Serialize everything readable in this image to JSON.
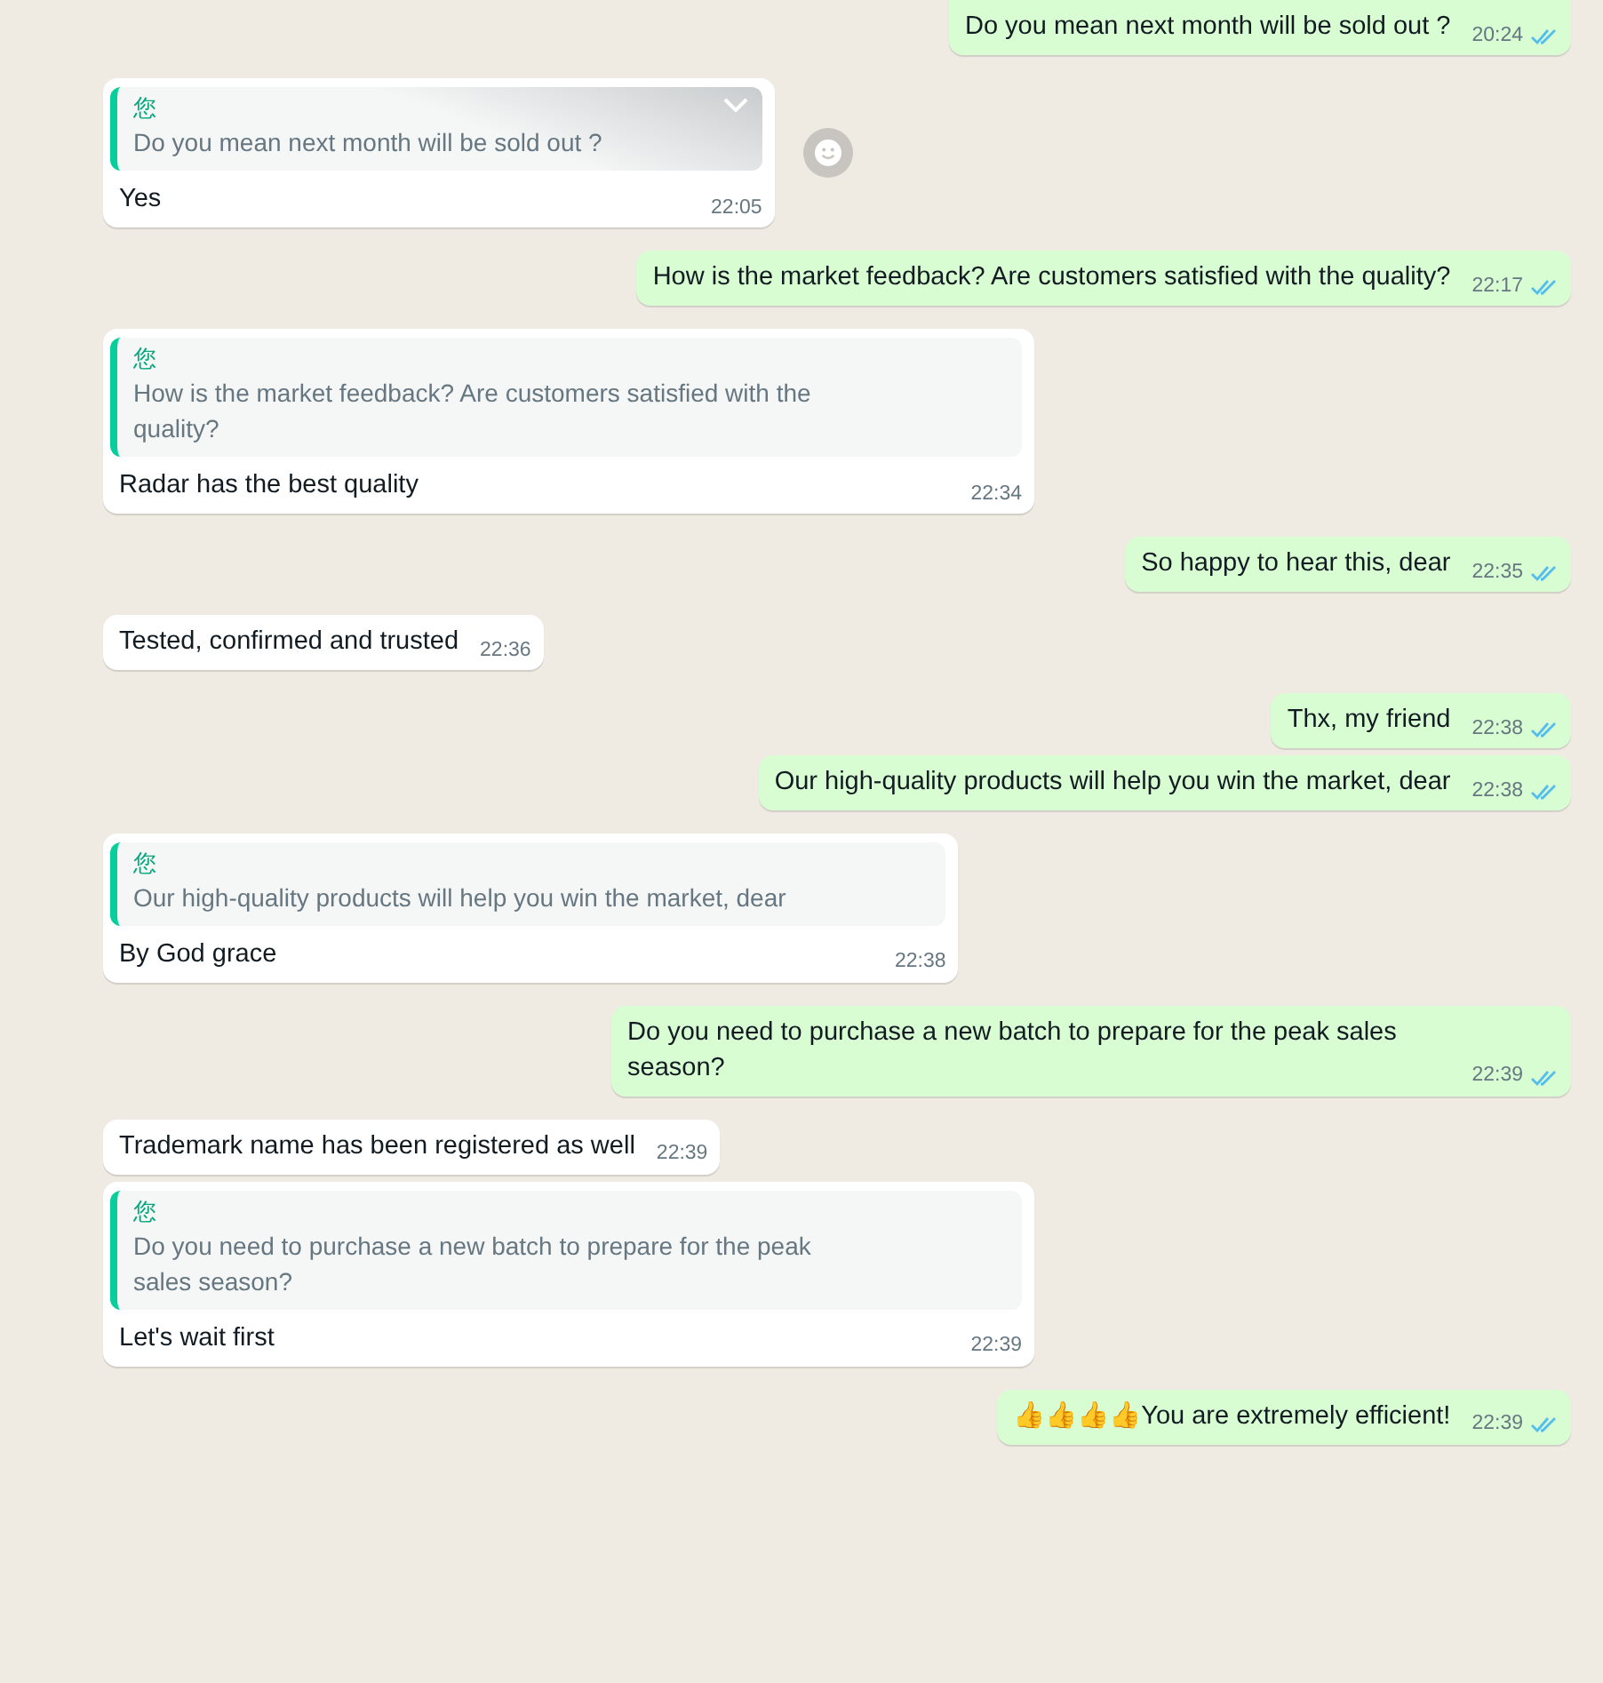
{
  "messages": [
    {
      "outgoing": true,
      "text": "Do you mean next month will be sold out ?",
      "time": "20:24",
      "read": true
    },
    {
      "outgoing": false,
      "quote": {
        "author": "您",
        "text": "Do you mean next month will be sold out ?"
      },
      "text": "Yes",
      "time": "22:05",
      "hovered": true
    },
    {
      "outgoing": true,
      "text": "How is the market feedback? Are customers satisfied with the quality?",
      "time": "22:17",
      "read": true
    },
    {
      "outgoing": false,
      "quote": {
        "author": "您",
        "text": "How is the market feedback? Are customers satisfied with the quality?"
      },
      "text": "Radar has the best quality",
      "time": "22:34"
    },
    {
      "outgoing": true,
      "text": "So happy to hear this, dear",
      "time": "22:35",
      "read": true
    },
    {
      "outgoing": false,
      "text": "Tested, confirmed and trusted",
      "time": "22:36"
    },
    {
      "outgoing": true,
      "text": "Thx, my friend",
      "time": "22:38",
      "read": true
    },
    {
      "outgoing": true,
      "text": "Our high-quality products will help you win the market, dear",
      "time": "22:38",
      "read": true
    },
    {
      "outgoing": false,
      "quote": {
        "author": "您",
        "text": "Our high-quality products will help you win the market, dear"
      },
      "text": "By God grace",
      "time": "22:38"
    },
    {
      "outgoing": true,
      "text": "Do you need to purchase a new batch to prepare for the peak sales season?",
      "time": "22:39",
      "read": true
    },
    {
      "outgoing": false,
      "text": "Trademark name has been registered as well",
      "time": "22:39"
    },
    {
      "outgoing": false,
      "quote": {
        "author": "您",
        "text": "Do you need to purchase a new batch to prepare for the peak sales season?"
      },
      "text": "Let's wait first",
      "time": "22:39"
    },
    {
      "outgoing": true,
      "text": "👍👍👍👍You are extremely efficient!",
      "time": "22:39",
      "read": true
    }
  ]
}
